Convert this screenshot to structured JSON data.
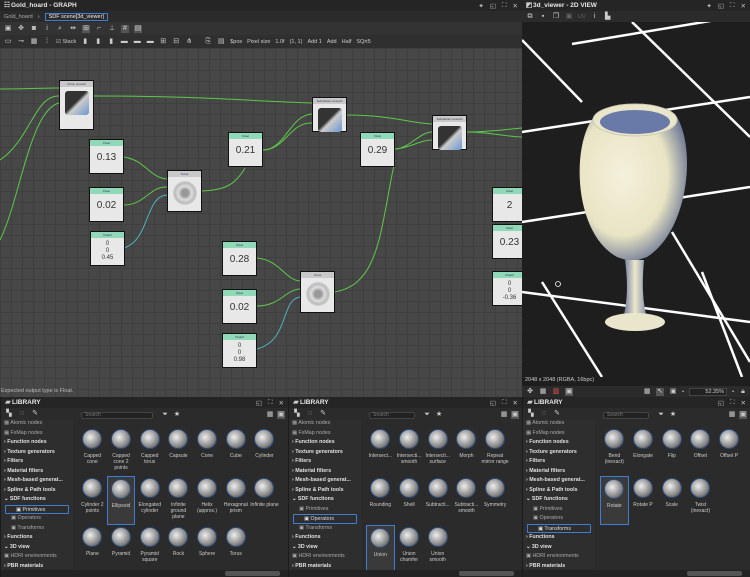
{
  "graph": {
    "title": "Gold_hoard - GRAPH",
    "breadcrumb": [
      "Gold_hoard",
      "SDF scene[3d_viewer]"
    ],
    "toolbar2": {
      "stack": "Stack",
      "items": [
        "$pos",
        "Pixel size",
        "1.0f",
        "(1, 1)",
        "Add 1",
        "Add",
        "Half",
        "SQrt5"
      ]
    },
    "status": "Expected output type is Float.",
    "nodes": [
      {
        "type": "op",
        "header": "Union smooth",
        "icon": "union-smooth"
      },
      {
        "type": "float",
        "header": "Float",
        "value": "0.13"
      },
      {
        "type": "float",
        "header": "Float",
        "value": "0.02"
      },
      {
        "type": "float3",
        "header": "Float3",
        "values": [
          "0",
          "0",
          "0.45"
        ]
      },
      {
        "type": "op",
        "header": "Torus",
        "icon": "torus"
      },
      {
        "type": "float",
        "header": "Float",
        "value": "0.21"
      },
      {
        "type": "op",
        "header": "Subtraction smooth",
        "icon": "subtraction-smooth"
      },
      {
        "type": "float",
        "header": "Float",
        "value": "0.29"
      },
      {
        "type": "op",
        "header": "Subtraction smooth",
        "icon": "subtraction-smooth"
      },
      {
        "type": "float",
        "header": "Float",
        "value": "2"
      },
      {
        "type": "float",
        "header": "Float",
        "value": "0.23"
      },
      {
        "type": "float3",
        "header": "Float3",
        "values": [
          "0",
          "0",
          "-0.36"
        ]
      },
      {
        "type": "float",
        "header": "Float",
        "value": "0.28"
      },
      {
        "type": "float",
        "header": "Float",
        "value": "0.02"
      },
      {
        "type": "float3",
        "header": "Float3",
        "values": [
          "0",
          "0",
          "0.98"
        ]
      },
      {
        "type": "op",
        "header": "Torus",
        "icon": "torus"
      }
    ]
  },
  "viewer": {
    "title": "3d_viewer - 2D VIEW",
    "uv": "UV",
    "info": "2048 x 2048 (RGBA, 16bpc)",
    "zoom": "52.35%"
  },
  "tree": [
    "Atomic nodes",
    "FxMap nodes",
    "Function nodes",
    "Texture generators",
    "Filters",
    "Material filters",
    "Mesh-based generat...",
    "Spline & Path tools",
    "SDF functions",
    "Primitives",
    "Operators",
    "Transforms",
    "Functions",
    "3D view",
    "HDRI environments",
    "PBR materials"
  ],
  "libraries": [
    {
      "title": "LIBRARY",
      "search_placeholder": "Search",
      "selected_category": "Primitives",
      "selected_item": "Ellipsoid",
      "items": [
        "Capped cone",
        "Capped cone 2 points",
        "Capped torus",
        "Capsule",
        "Cone",
        "Cube",
        "Cylinder",
        "Cylinder 2 points",
        "Ellipsoid",
        "Elongated cylinder",
        "Infinite ground plane",
        "Helix (approx.)",
        "Hexagonal prism",
        "Infinite plane",
        "Plane",
        "Pyramid",
        "Pyramid square",
        "Rock",
        "Sphere",
        "Torus"
      ]
    },
    {
      "title": "LIBRARY",
      "search_placeholder": "Search",
      "selected_category": "Operators",
      "selected_item": "Union",
      "items": [
        "Intersect...",
        "Intersecti... smooth",
        "Intersecti... surface",
        "Morph",
        "Repeat mirror range",
        "Rounding",
        "Shell",
        "Subtracti...",
        "Subtracti... smooth",
        "Symmetry",
        "Union",
        "Union chamfer",
        "Union smooth"
      ]
    },
    {
      "title": "LIBRARY",
      "search_placeholder": "Search",
      "selected_category": "Transforms",
      "selected_item": "Rotate",
      "items": [
        "Bend (inexact)",
        "Elongate",
        "Flip",
        "Offset",
        "Offset P",
        "Rotate",
        "Rotate P",
        "Scale",
        "Twist (inexact)"
      ]
    }
  ]
}
